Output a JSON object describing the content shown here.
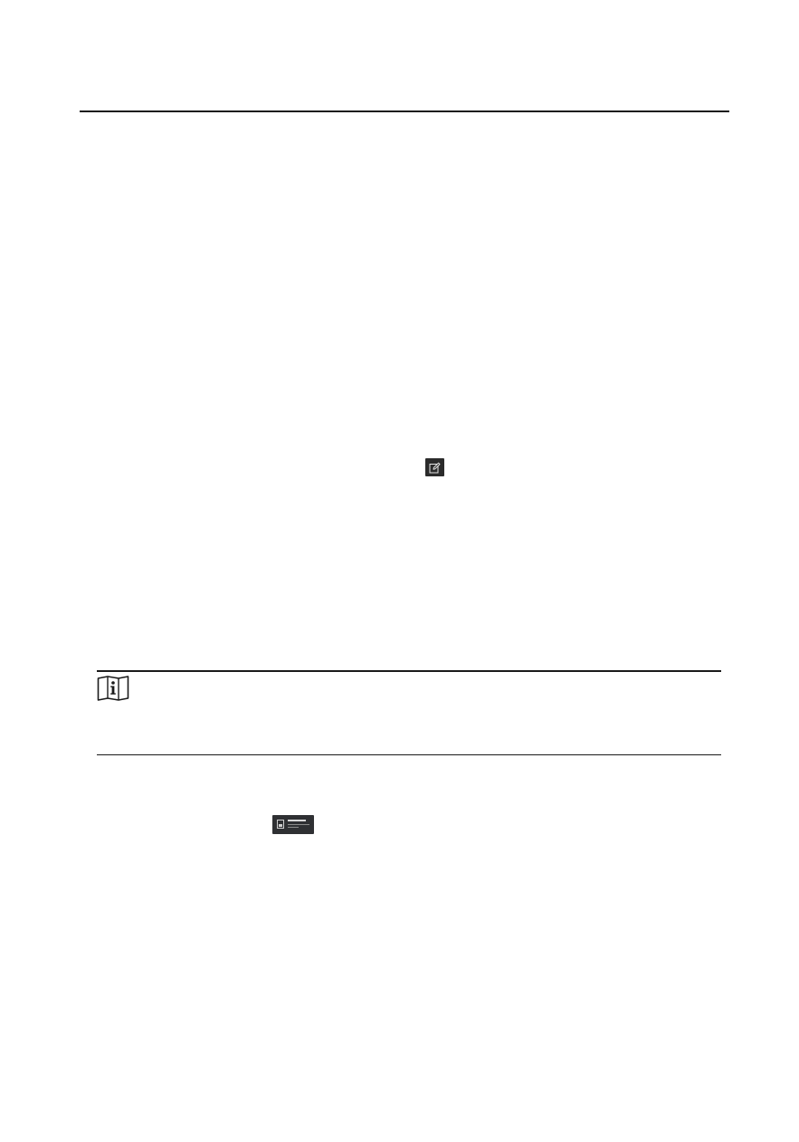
{
  "page": {
    "header_rule": true,
    "icons": {
      "edit": "edit-icon",
      "note": "note-info-icon",
      "thumbnail": "panel-thumbnail-icon"
    },
    "colors": {
      "rule": "#1a1a1a",
      "edit_icon_bg": "#2b2b2b",
      "thumbnail_bg": "#2f3033"
    }
  }
}
